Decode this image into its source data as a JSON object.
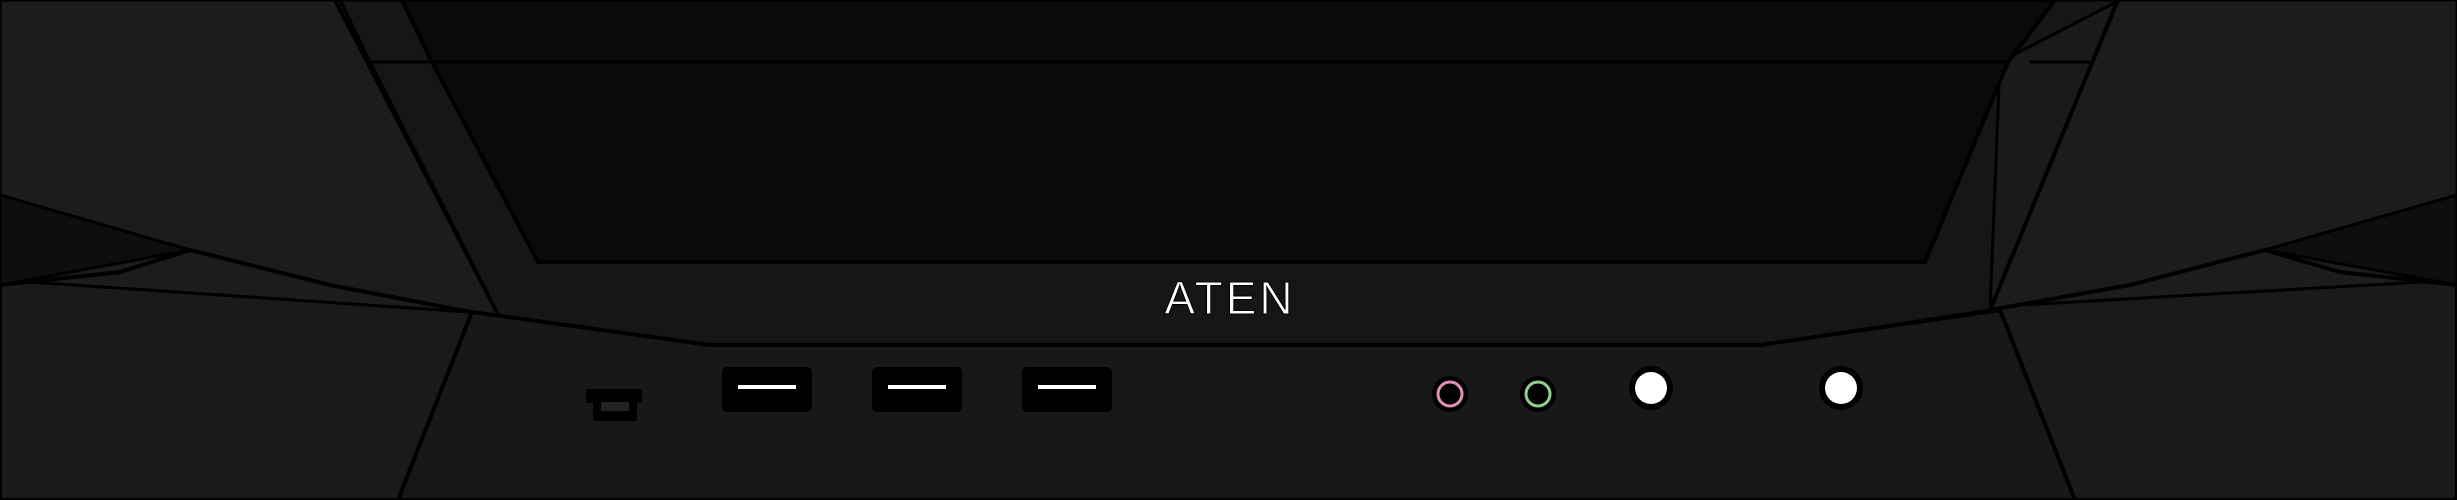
{
  "device": {
    "brand_logo": "ATEN",
    "colors": {
      "chassis": "#1a1a1a",
      "recess": "#0a0a0a",
      "side_panel": "#1f1f1f",
      "outline": "#000000",
      "usb_slot": "#000000",
      "usb_tongue": "#ffffff",
      "mic_ring": "#e38fb7",
      "speaker_ring": "#8fd18a",
      "indicator": "#ffffff"
    },
    "ports": [
      {
        "name": "mini-usb-port",
        "icon": "mini-usb-port-icon"
      },
      {
        "name": "usb-port-1",
        "icon": "usb-a-port-icon"
      },
      {
        "name": "usb-port-2",
        "icon": "usb-a-port-icon"
      },
      {
        "name": "usb-port-3",
        "icon": "usb-a-port-icon"
      },
      {
        "name": "microphone-jack",
        "icon": "audio-jack-icon"
      },
      {
        "name": "speaker-jack",
        "icon": "audio-jack-icon"
      }
    ],
    "buttons": [
      {
        "name": "left-round-button",
        "icon": "round-button-icon"
      },
      {
        "name": "right-round-button",
        "icon": "round-button-icon"
      }
    ]
  }
}
